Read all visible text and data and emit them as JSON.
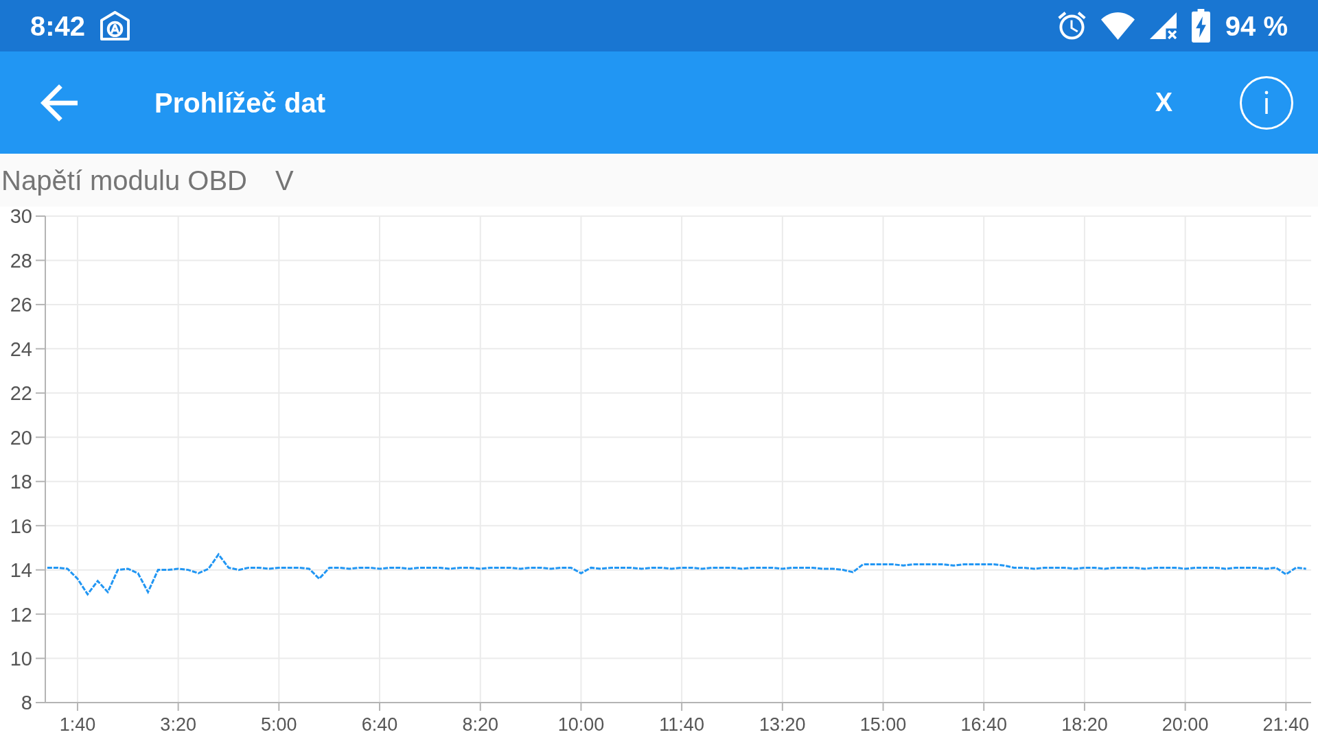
{
  "status_bar": {
    "time": "8:42",
    "battery": "94 %"
  },
  "app_bar": {
    "title": "Prohlížeč dat",
    "close_label": "X"
  },
  "parameter": {
    "name": "Napětí modulu OBD",
    "unit": "V"
  },
  "chart": {
    "chart_data": {
      "type": "line",
      "grid": true,
      "x": [
        70,
        80,
        90,
        100,
        110,
        120,
        130,
        140,
        150,
        160,
        170,
        180,
        190,
        200,
        210,
        220,
        230,
        240,
        250,
        260,
        270,
        280,
        290,
        300,
        310,
        320,
        330,
        340,
        350,
        360,
        370,
        380,
        390,
        400,
        410,
        420,
        430,
        440,
        450,
        460,
        470,
        480,
        490,
        500,
        510,
        520,
        530,
        540,
        550,
        560,
        570,
        580,
        590,
        600,
        610,
        620,
        630,
        640,
        650,
        660,
        670,
        680,
        690,
        700,
        710,
        720,
        730,
        740,
        750,
        760,
        770,
        780,
        790,
        800,
        810,
        820,
        830,
        840,
        850,
        860,
        870,
        880,
        890,
        900,
        910,
        920,
        930,
        940,
        950,
        960,
        970,
        980,
        990,
        1000,
        1010,
        1020,
        1030,
        1040,
        1050,
        1060,
        1070,
        1080,
        1090,
        1100,
        1110,
        1120,
        1130,
        1140,
        1150,
        1160,
        1170,
        1180,
        1190,
        1200,
        1210,
        1220,
        1230,
        1240,
        1250,
        1260,
        1270,
        1280,
        1290,
        1300,
        1310,
        1320
      ],
      "series": [
        {
          "color": "#2196f3",
          "line_style": "dashed",
          "values": [
            14.1,
            14.1,
            14.05,
            13.6,
            12.9,
            13.5,
            13.0,
            14.0,
            14.05,
            13.85,
            13.0,
            14.0,
            14.0,
            14.05,
            14.0,
            13.85,
            14.05,
            14.7,
            14.1,
            14.0,
            14.1,
            14.1,
            14.05,
            14.1,
            14.1,
            14.1,
            14.05,
            13.6,
            14.1,
            14.1,
            14.05,
            14.1,
            14.1,
            14.05,
            14.1,
            14.1,
            14.05,
            14.1,
            14.1,
            14.1,
            14.05,
            14.1,
            14.1,
            14.05,
            14.1,
            14.1,
            14.1,
            14.05,
            14.1,
            14.1,
            14.05,
            14.1,
            14.1,
            13.85,
            14.1,
            14.05,
            14.1,
            14.1,
            14.1,
            14.05,
            14.1,
            14.1,
            14.05,
            14.1,
            14.1,
            14.05,
            14.1,
            14.1,
            14.1,
            14.05,
            14.1,
            14.1,
            14.1,
            14.05,
            14.1,
            14.1,
            14.1,
            14.05,
            14.05,
            14.0,
            13.9,
            14.25,
            14.25,
            14.25,
            14.25,
            14.2,
            14.25,
            14.25,
            14.25,
            14.25,
            14.2,
            14.25,
            14.25,
            14.25,
            14.25,
            14.2,
            14.1,
            14.1,
            14.05,
            14.1,
            14.1,
            14.1,
            14.05,
            14.1,
            14.1,
            14.05,
            14.1,
            14.1,
            14.1,
            14.05,
            14.1,
            14.1,
            14.1,
            14.05,
            14.1,
            14.1,
            14.1,
            14.05,
            14.1,
            14.1,
            14.1,
            14.05,
            14.1,
            13.8,
            14.1,
            14.05
          ]
        }
      ],
      "xlim": [
        68,
        1325
      ],
      "ylim": [
        8,
        30
      ],
      "xticks": [
        {
          "value": 100,
          "label": "1:40"
        },
        {
          "value": 200,
          "label": "3:20"
        },
        {
          "value": 300,
          "label": "5:00"
        },
        {
          "value": 400,
          "label": "6:40"
        },
        {
          "value": 500,
          "label": "8:20"
        },
        {
          "value": 600,
          "label": "10:00"
        },
        {
          "value": 700,
          "label": "11:40"
        },
        {
          "value": 800,
          "label": "13:20"
        },
        {
          "value": 900,
          "label": "15:00"
        },
        {
          "value": 1000,
          "label": "16:40"
        },
        {
          "value": 1100,
          "label": "18:20"
        },
        {
          "value": 1200,
          "label": "20:00"
        },
        {
          "value": 1300,
          "label": "21:40"
        }
      ],
      "yticks": [
        8,
        10,
        12,
        14,
        16,
        18,
        20,
        22,
        24,
        26,
        28,
        30
      ]
    }
  }
}
